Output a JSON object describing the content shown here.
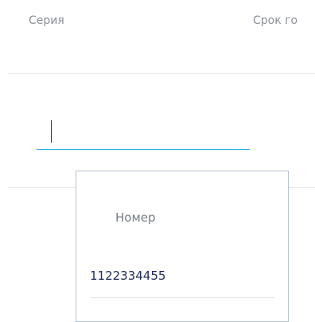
{
  "table": {
    "columns": [
      "Серия",
      "Срок го"
    ]
  },
  "series_field": {
    "value": ""
  },
  "dropdown": {
    "header": "Номер",
    "options": [
      "1122334455"
    ]
  },
  "colors": {
    "accent": "#2fb3e0",
    "header_text": "#8a8f98",
    "option_text": "#1e2a55",
    "dropdown_border": "#b7c1d0",
    "divider": "#e3e6ea"
  }
}
